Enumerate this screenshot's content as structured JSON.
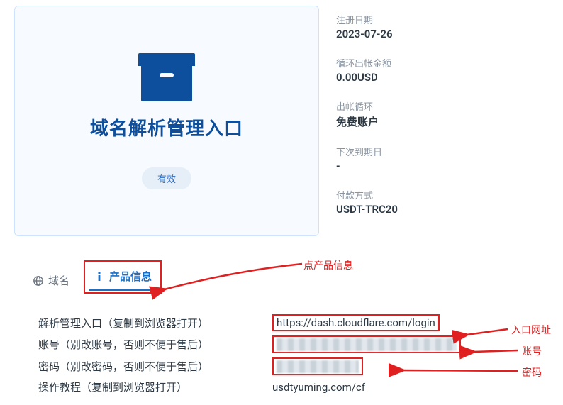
{
  "card": {
    "title": "域名解析管理入口",
    "status": "有效"
  },
  "info": {
    "reg_date_label": "注册日期",
    "reg_date_value": "2023-07-26",
    "loop_amount_label": "循环出帐金额",
    "loop_amount_value": "0.00USD",
    "out_cycle_label": "出帐循环",
    "out_cycle_value": "免费账户",
    "next_due_label": "下次到期日",
    "next_due_value": "-",
    "pay_method_label": "付款方式",
    "pay_method_value": "USDT-TRC20"
  },
  "tabs": {
    "domain": "域名",
    "product": "产品信息"
  },
  "details": {
    "row1_label": "解析管理入口（复制到浏览器打开）",
    "row1_value": "https://dash.cloudflare.com/login",
    "row2_label": "账号（别改账号，否则不便于售后）",
    "row3_label": "密码（别改密码，否则不便于售后）",
    "row4_label": "操作教程（复制到浏览器打开）",
    "row4_value": "usdtyuming.com/cf"
  },
  "annotations": {
    "click_product": "点产品信息",
    "entry_url": "入口网址",
    "account": "账号",
    "password": "密码"
  }
}
